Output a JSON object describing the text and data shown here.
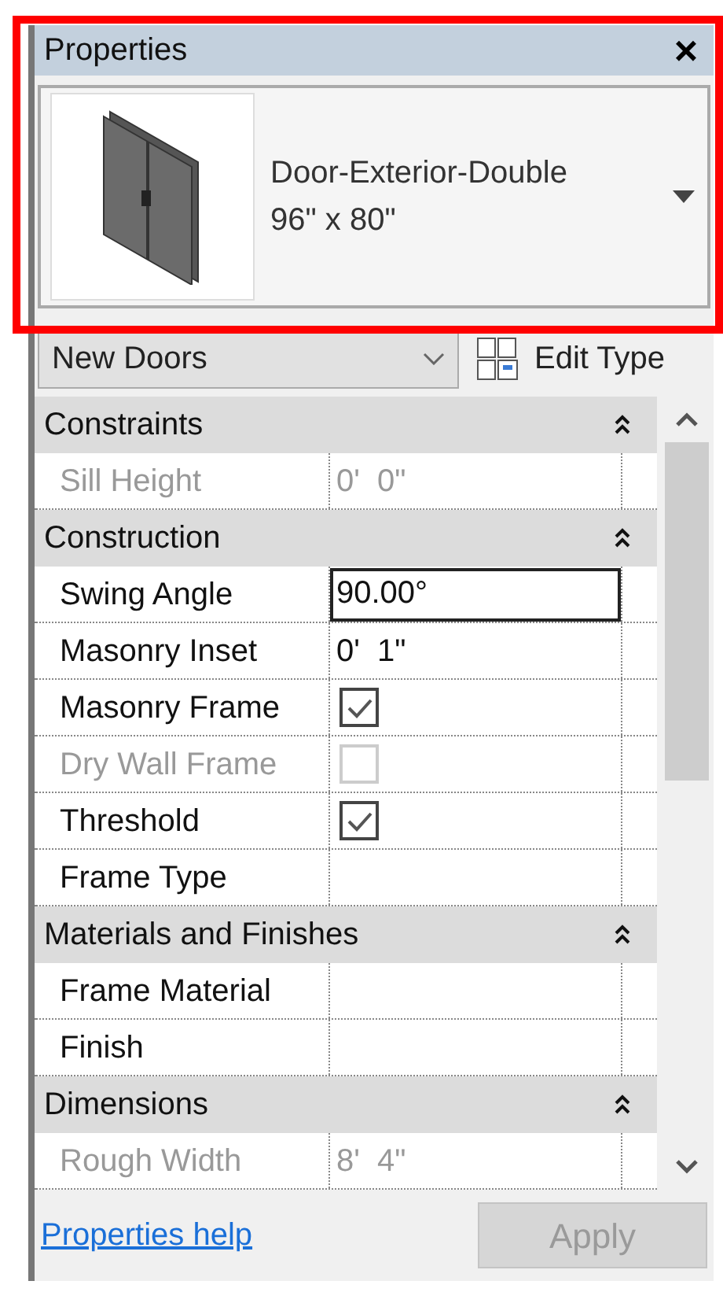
{
  "window": {
    "title": "Properties",
    "close": "×"
  },
  "type_selector": {
    "name": "Door-Exterior-Double",
    "size": "96\" x 80\""
  },
  "instance_filter": {
    "value": "New Doors"
  },
  "edit_type": {
    "label": "Edit Type"
  },
  "sections": [
    {
      "title": "Constraints",
      "expanded": true,
      "rows": [
        {
          "label": "Sill Height",
          "kind": "text",
          "value": "0'  0\"",
          "disabled": true,
          "editing": false
        }
      ]
    },
    {
      "title": "Construction",
      "expanded": true,
      "rows": [
        {
          "label": "Swing Angle",
          "kind": "text",
          "value": "90.00°",
          "disabled": false,
          "editing": true
        },
        {
          "label": "Masonry Inset",
          "kind": "text",
          "value": "0'  1\"",
          "disabled": false,
          "editing": false
        },
        {
          "label": "Masonry Frame",
          "kind": "checkbox",
          "checked": true,
          "disabled": false
        },
        {
          "label": "Dry Wall Frame",
          "kind": "checkbox",
          "checked": false,
          "disabled": true
        },
        {
          "label": "Threshold",
          "kind": "checkbox",
          "checked": true,
          "disabled": false
        },
        {
          "label": "Frame Type",
          "kind": "text",
          "disabled": false,
          "editing": false
        }
      ]
    },
    {
      "title": "Materials and Finishes",
      "expanded": true,
      "rows": [
        {
          "label": "Frame Material",
          "kind": "text",
          "disabled": false,
          "editing": false
        },
        {
          "label": "Finish",
          "kind": "text",
          "disabled": false,
          "editing": false
        }
      ]
    },
    {
      "title": "Dimensions",
      "expanded": true,
      "rows": [
        {
          "label": "Rough Width",
          "kind": "text",
          "value": "8'  4\"",
          "disabled": true,
          "editing": false
        }
      ]
    }
  ],
  "footer": {
    "help_link": "Properties help",
    "apply": {
      "label": "Apply",
      "disabled": true
    }
  }
}
